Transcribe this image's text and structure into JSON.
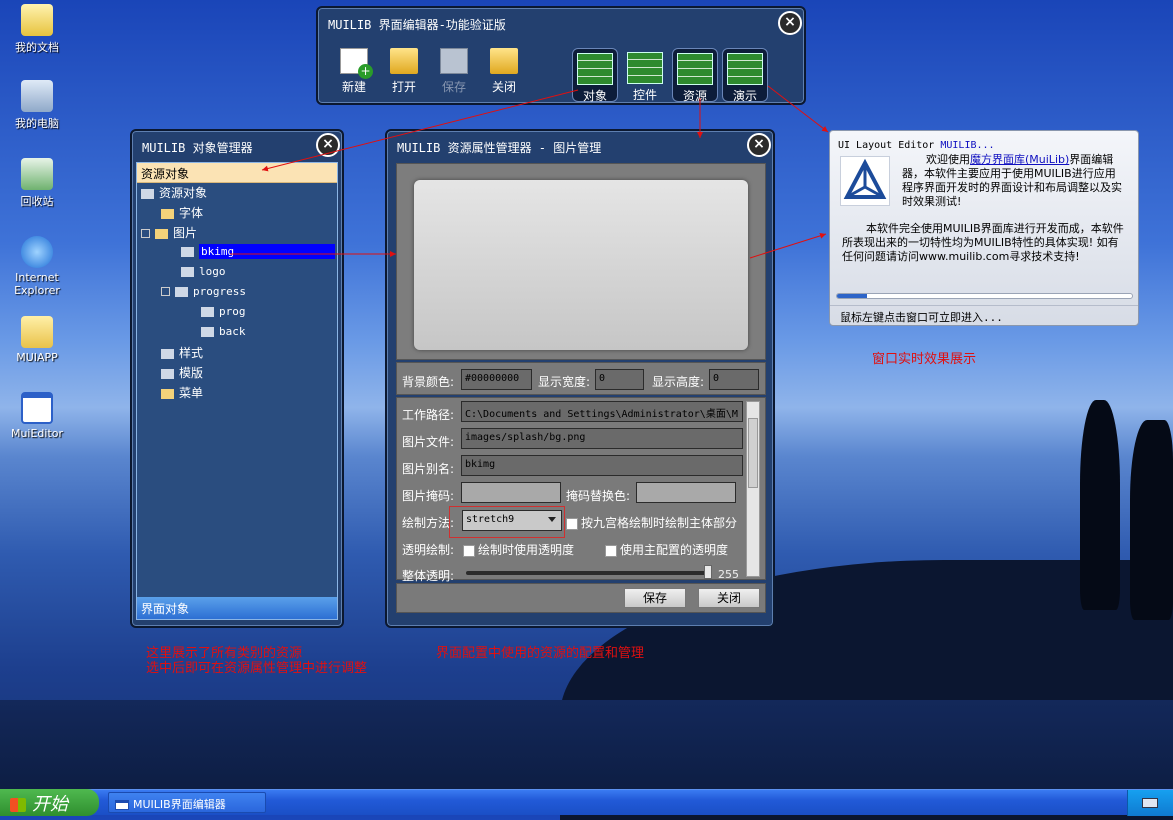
{
  "desktop": {
    "icons": [
      {
        "label": "我的文档",
        "icon": "my-documents-icon"
      },
      {
        "label": "我的电脑",
        "icon": "my-computer-icon"
      },
      {
        "label": "回收站",
        "icon": "recycle-bin-icon"
      },
      {
        "label": "Internet Explorer",
        "icon": "internet-explorer-icon"
      },
      {
        "label": "MUIAPP",
        "icon": "folder-icon"
      },
      {
        "label": "MuiEditor",
        "icon": "window-icon"
      }
    ]
  },
  "main_toolbar": {
    "title": "MUILIB 界面编辑器-功能验证版",
    "buttons": [
      "新建",
      "打开",
      "保存",
      "关闭"
    ],
    "modes": [
      "对象",
      "控件",
      "资源",
      "演示"
    ]
  },
  "object_manager": {
    "title": "MUILIB 对象管理器",
    "header": "资源对象",
    "footer": "界面对象",
    "tree": [
      "资源对象",
      "字体",
      "图片",
      "bkimg",
      "logo",
      "progress",
      "prog",
      "back",
      "样式",
      "模版",
      "菜单"
    ]
  },
  "resource_manager": {
    "title": "MUILIB 资源属性管理器 - 图片管理",
    "bg_color_label": "背景颜色:",
    "bg_color_value": "#00000000",
    "width_label": "显示宽度:",
    "width_value": "0",
    "height_label": "显示高度:",
    "height_value": "0",
    "work_path_label": "工作路径:",
    "work_path_value": "C:\\Documents and Settings\\Administrator\\桌面\\M",
    "image_file_label": "图片文件:",
    "image_file_value": "images/splash/bg.png",
    "alias_label": "图片别名:",
    "alias_value": "bkimg",
    "mask_label": "图片掩码:",
    "mask_value": "",
    "mask_replace_label": "掩码替换色:",
    "mask_replace_value": "",
    "draw_method_label": "绘制方法:",
    "draw_method_value": "stretch9",
    "nine_grid_label": "按九宫格绘制时绘制主体部分",
    "transparent_label": "透明绘制:",
    "use_alpha_label": "绘制时使用透明度",
    "use_main_alpha_label": "使用主配置的透明度",
    "overall_alpha_label": "整体透明:",
    "overall_alpha_value": "255",
    "save_label": "保存",
    "close_label": "关闭"
  },
  "splash": {
    "title_prefix": "UI Layout Editor ",
    "title_link": "MUILIB...",
    "para1_a": "欢迎使用",
    "para1_link": "魔方界面库(MuiLib)",
    "para1_b": "界面编辑器，本软件主要应用于使用MUILIB进行应用程序界面开发时的界面设计和布局调整以及实时效果测试!",
    "para2": "本软件完全使用MUILIB界面库进行开发而成，本软件所表现出来的一切特性均为MUILIB特性的具体实现! 如有任何问题请访问www.muilib.com寻求技术支持!",
    "progress": 0.1,
    "footer": "鼠标左键点击窗口可立即进入..."
  },
  "annotations": {
    "realtime": "窗口实时效果展示",
    "tree_note_1": "这里展示了所有类别的资源",
    "tree_note_2": "选中后即可在资源属性管理中进行调整",
    "config_note": "界面配置中使用的资源的配置和管理"
  },
  "taskbar": {
    "start_label": "开始",
    "task_label": "MUILIB界面编辑器"
  },
  "colors": {
    "annotation_red": "#e01010",
    "window_bg": "#23406f",
    "tree_selection": "#0000ff"
  }
}
